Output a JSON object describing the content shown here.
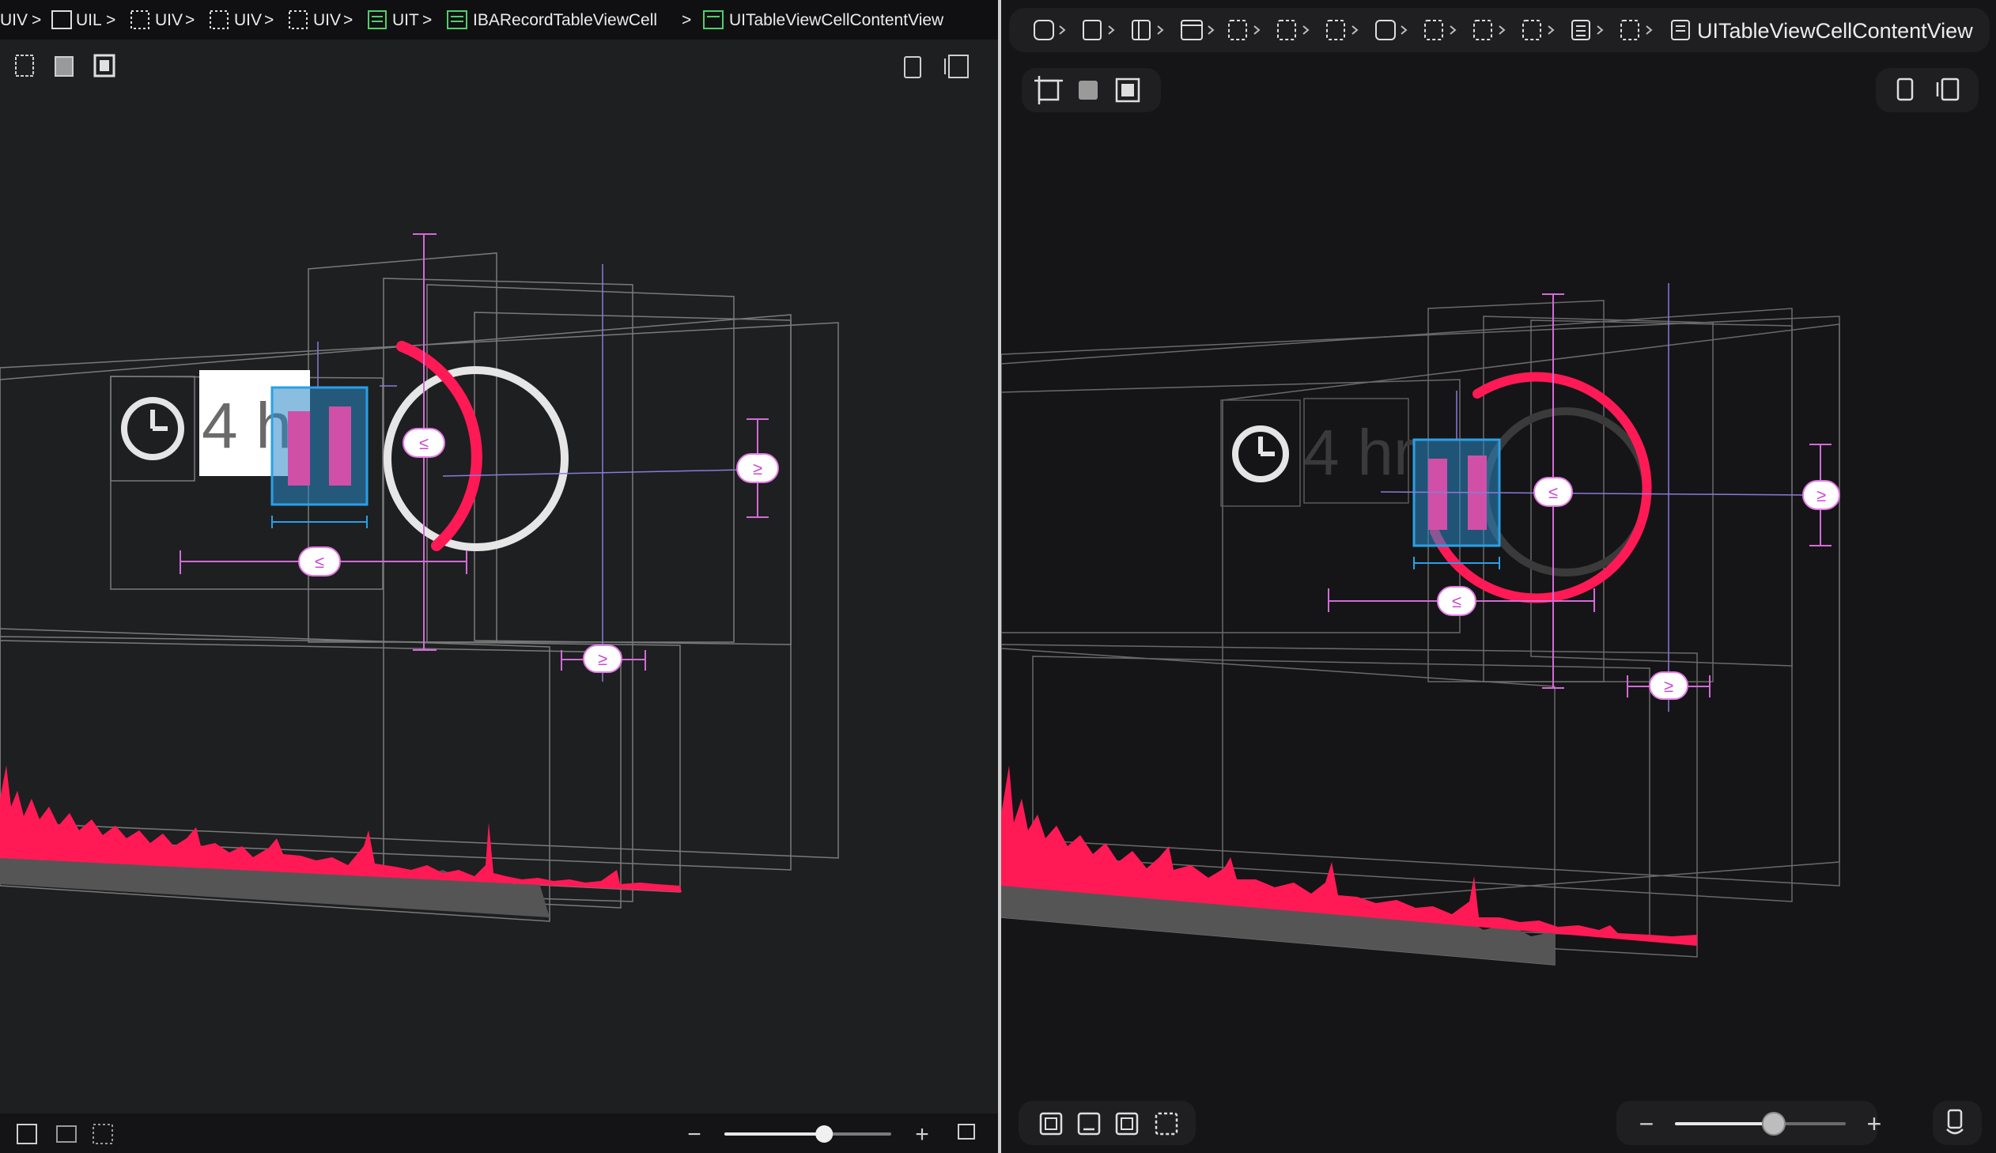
{
  "left_pane": {
    "breadcrumb": [
      {
        "label": "UIV",
        "icon": "dashed-view-icon"
      },
      {
        "label": "UIL",
        "icon": "label-icon"
      },
      {
        "label": "UIV",
        "icon": "dashed-view-icon"
      },
      {
        "label": "UIV",
        "icon": "dashed-view-icon"
      },
      {
        "label": "UIV",
        "icon": "dashed-view-icon"
      },
      {
        "label": "UIT",
        "icon": "table-icon"
      },
      {
        "label": "IBARecordTableViewCell",
        "icon": "table-cell-icon"
      },
      {
        "label": "UITableViewCellContentView",
        "icon": "content-view-icon"
      }
    ],
    "canvas": {
      "time_label": "4 h",
      "constraint_badges": [
        "≤",
        "≥",
        "≤",
        "≥"
      ]
    },
    "bottom_bar": {
      "zoom_out": "−",
      "zoom_in": "+",
      "zoom_level": 0.6
    }
  },
  "right_pane": {
    "breadcrumb_last": "UITableViewCellContentView",
    "breadcrumb_icons": [
      "app-icon",
      "view-icon",
      "split-view-icon",
      "window-icon",
      "dashed-view-icon",
      "dashed-view-icon",
      "dashed-view-icon",
      "rounded-view-icon",
      "dashed-view-icon",
      "dashed-view-icon",
      "dashed-view-icon",
      "list-icon",
      "dashed-view-icon"
    ],
    "canvas": {
      "time_label": "4 hr",
      "constraint_badges": [
        "≤",
        "≥",
        "≤",
        "≥"
      ]
    },
    "bottom_bar": {
      "zoom_out": "−",
      "zoom_in": "+",
      "zoom_level": 0.58
    }
  },
  "colors": {
    "accent_pink": "#ff1a55",
    "constraint_magenta": "#e57ae6",
    "selection_blue": "#2aa0e6",
    "frame_gray": "#8a8a8a"
  }
}
